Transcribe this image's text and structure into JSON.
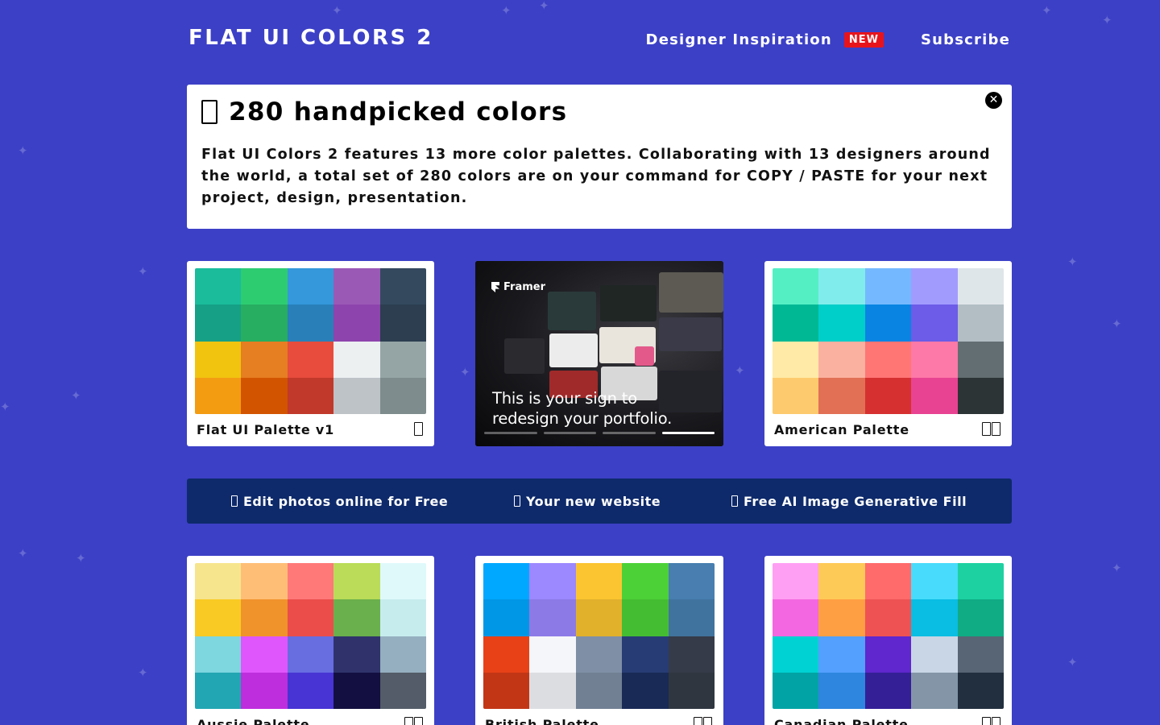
{
  "header": {
    "logo": "FLAT UI COLORS 2",
    "nav_inspiration": "Designer Inspiration",
    "nav_badge": "NEW",
    "nav_subscribe": "Subscribe"
  },
  "banner": {
    "title": "280 handpicked colors",
    "text": "Flat UI Colors 2 features 13 more color palettes. Collaborating with 13 designers around the world, a total set of 280 colors are on your command for COPY / PASTE for your next project, design, presentation."
  },
  "ad": {
    "brand": "Framer",
    "headline_line1": "This is your sign to",
    "headline_line2": "redesign your portfolio."
  },
  "links": {
    "edit_photos": "Edit photos online for Free",
    "new_website": "Your new website",
    "ai_fill": "Free AI Image Generative Fill"
  },
  "palettes": [
    {
      "name": "Flat UI Palette v1",
      "colors": [
        "#1abc9c",
        "#2ecc71",
        "#3498db",
        "#9b59b6",
        "#34495e",
        "#16a085",
        "#27ae60",
        "#2980b9",
        "#8e44ad",
        "#2c3e50",
        "#f1c40f",
        "#e67e22",
        "#e74c3c",
        "#ecf0f1",
        "#95a5a6",
        "#f39c12",
        "#d35400",
        "#c0392b",
        "#bdc3c7",
        "#7f8c8d"
      ]
    },
    {
      "name": "American Palette",
      "colors": [
        "#55efc4",
        "#81ecec",
        "#74b9ff",
        "#a29bfe",
        "#dfe6e9",
        "#00b894",
        "#00cec9",
        "#0984e3",
        "#6c5ce7",
        "#b2bec3",
        "#ffeaa7",
        "#fab1a0",
        "#ff7675",
        "#fd79a8",
        "#636e72",
        "#fdcb6e",
        "#e17055",
        "#d63031",
        "#e84393",
        "#2d3436"
      ]
    },
    {
      "name": "Aussie Palette",
      "colors": [
        "#f6e58d",
        "#ffbe76",
        "#ff7979",
        "#badc58",
        "#dff9fb",
        "#f9ca24",
        "#f0932b",
        "#eb4d4b",
        "#6ab04c",
        "#c7ecee",
        "#7ed6df",
        "#e056fd",
        "#686de0",
        "#30336b",
        "#95afc0",
        "#22a6b3",
        "#be2edd",
        "#4834d4",
        "#130f40",
        "#535c68"
      ]
    },
    {
      "name": "British Palette",
      "colors": [
        "#00a8ff",
        "#9c88ff",
        "#fbc531",
        "#4cd137",
        "#487eb0",
        "#0097e6",
        "#8c7ae6",
        "#e1b12c",
        "#44bd32",
        "#40739e",
        "#e84118",
        "#f5f6fa",
        "#7f8fa6",
        "#273c75",
        "#353b48",
        "#c23616",
        "#dcdde1",
        "#718093",
        "#192a56",
        "#2f3640"
      ]
    },
    {
      "name": "Canadian Palette",
      "colors": [
        "#ff9ff3",
        "#feca57",
        "#ff6b6b",
        "#48dbfb",
        "#1dd1a1",
        "#f368e0",
        "#ff9f43",
        "#ee5253",
        "#0abde3",
        "#10ac84",
        "#00d2d3",
        "#54a0ff",
        "#5f27cd",
        "#c8d6e5",
        "#576574",
        "#01a3a4",
        "#2e86de",
        "#341f97",
        "#8395a7",
        "#222f3e"
      ]
    }
  ]
}
